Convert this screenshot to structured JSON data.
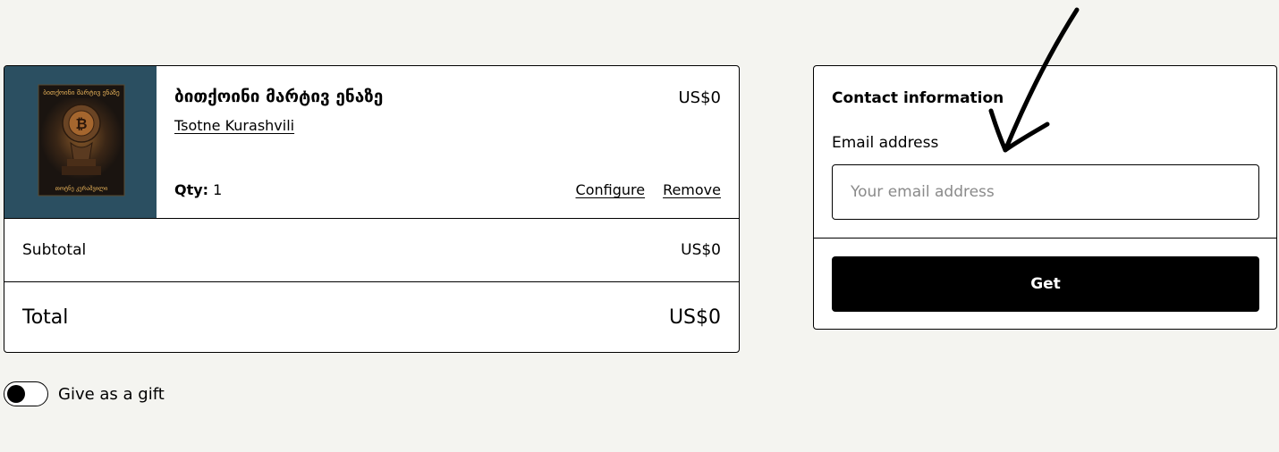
{
  "cart": {
    "item": {
      "cover_image": "book-cover-bitcoin-sculpture",
      "cover_top_text": "ბითქოინი მარტივ ენაზე",
      "cover_bottom_text": "თოტნე კურაშვილი",
      "title": "ბითქოინი მარტივ ენაზე",
      "author": "Tsotne Kurashvili",
      "price": "US$0",
      "qty_label": "Qty:",
      "qty_value": "1",
      "configure_label": "Configure",
      "remove_label": "Remove"
    },
    "subtotal": {
      "label": "Subtotal",
      "value": "US$0"
    },
    "total": {
      "label": "Total",
      "value": "US$0"
    }
  },
  "gift": {
    "label": "Give as a gift",
    "enabled": false
  },
  "contact": {
    "title": "Contact information",
    "email_label": "Email address",
    "email_placeholder": "Your email address",
    "email_value": "",
    "submit_label": "Get"
  },
  "annotation": {
    "type": "hand-drawn-arrow",
    "color": "#000000"
  },
  "colors": {
    "background": "#f4f4f0",
    "cover_background": "#2b4f61",
    "button": "#000000"
  }
}
